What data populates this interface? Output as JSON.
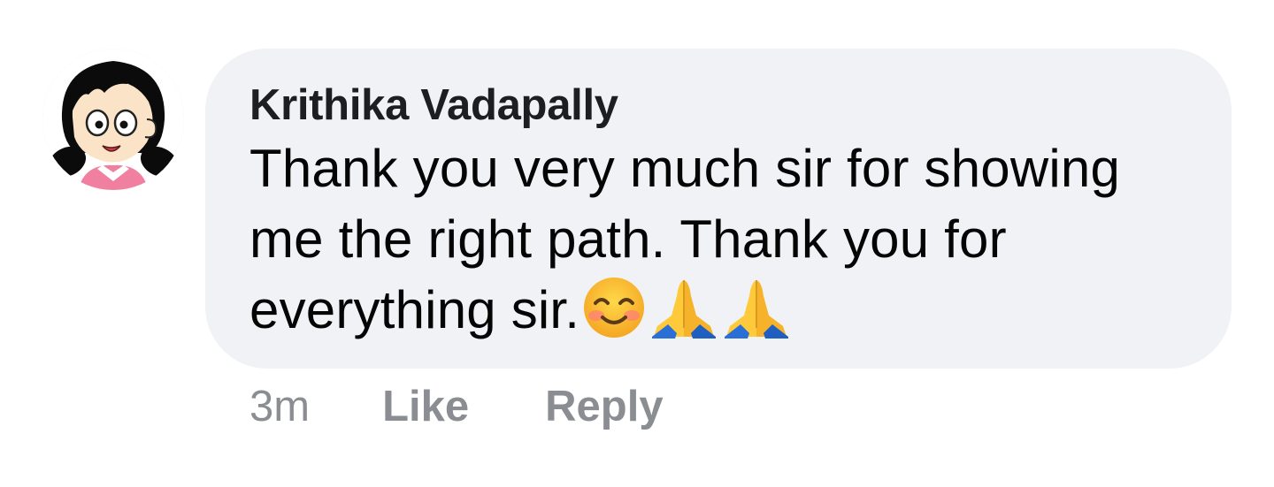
{
  "comment": {
    "author": "Krithika Vadapally",
    "text": "Thank you very much sir for showing me the right path. Thank you for everything sir.",
    "emojis": [
      "smiling-face-icon",
      "folded-hands-icon",
      "folded-hands-icon"
    ],
    "timestamp": "3m",
    "like_label": "Like",
    "reply_label": "Reply"
  },
  "colors": {
    "bubble_background": "#f0f2f5",
    "author_text": "#1c1e21",
    "body_text": "#050505",
    "meta_text": "#8a8d91"
  }
}
